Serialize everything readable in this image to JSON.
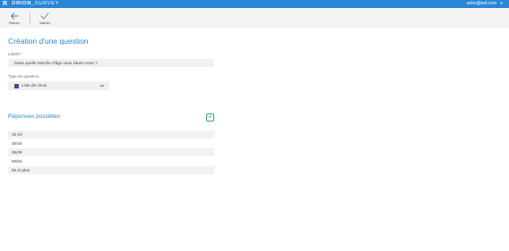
{
  "header": {
    "logo": "R",
    "app_name_bold": "ORION",
    "app_name_rest": "_SURVEY",
    "user_email": "orion@esl.com",
    "user_menu_icon": "chevron-down-icon"
  },
  "toolbar": {
    "back_label": "Retour",
    "back_icon": "arrow-left-icon",
    "validate_label": "Valider",
    "validate_icon": "check-icon"
  },
  "form": {
    "title": "Création d'une question",
    "label_field": {
      "label": "Libellé",
      "required_mark": "*",
      "value": "Dans quelle tranche d'âge vous situez-vous ?"
    },
    "type_field": {
      "label": "Type de question",
      "value": "Liste de choix",
      "icon": "list-icon"
    }
  },
  "answers_section": {
    "title": "Réponses possibles",
    "add_label": "+",
    "items": [
      "16-24",
      "25/34",
      "35/49",
      "50/64",
      "65 et plus"
    ]
  },
  "colors": {
    "accent": "#2a86d6",
    "add_button": "#3aa08a",
    "select_icon": "#3e4a9e",
    "field_bg": "#f0f0f0",
    "toolbar_bg": "#f4f4f4"
  }
}
